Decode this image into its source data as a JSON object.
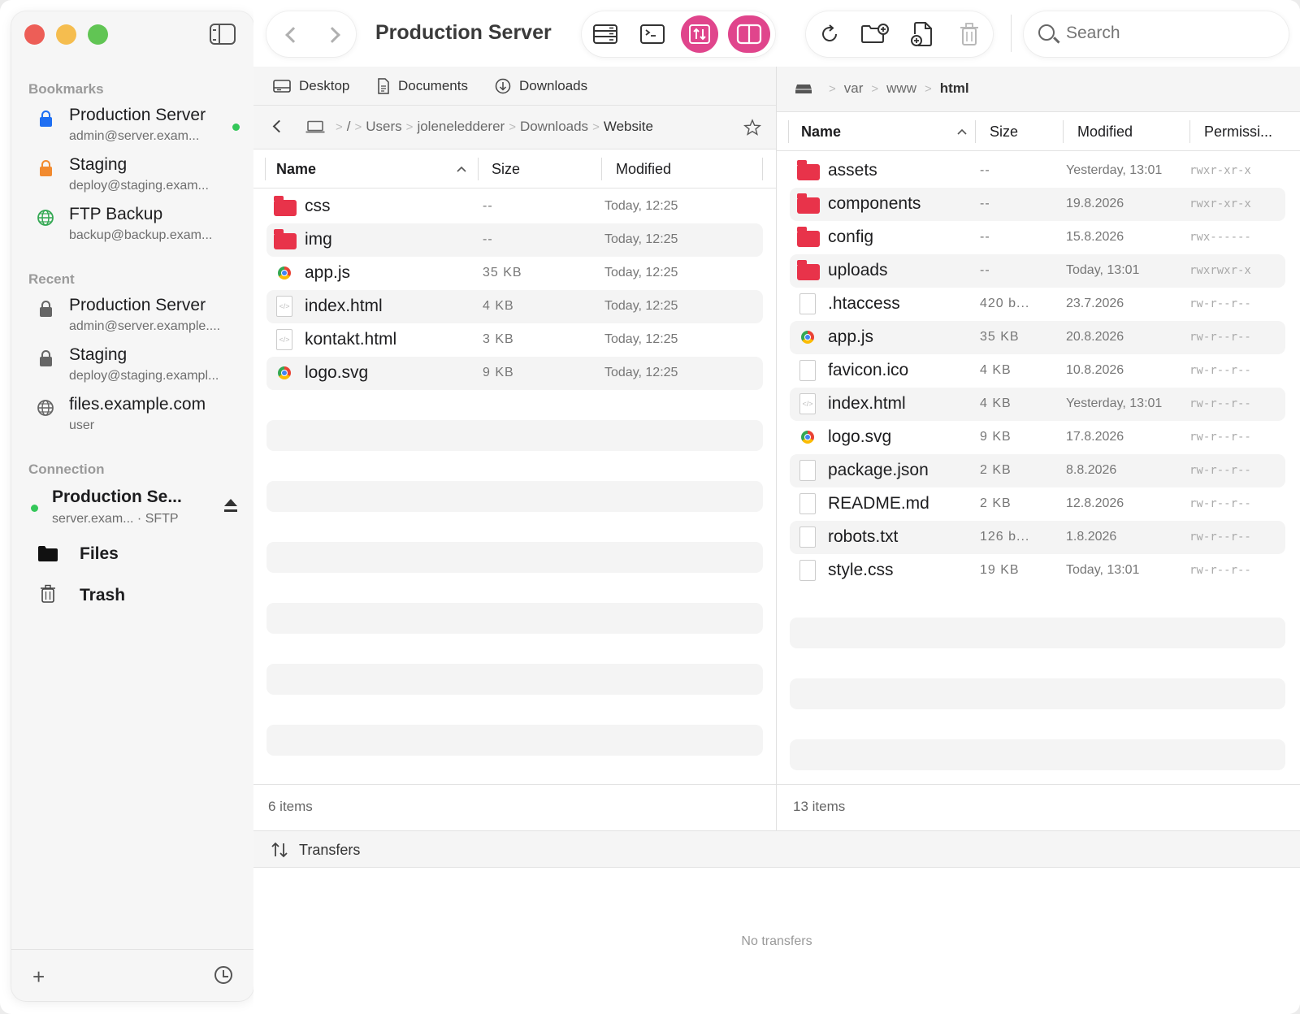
{
  "window": {
    "title": "Production Server",
    "traffic_lights": {
      "close": "#ed5e57",
      "minimize": "#f5bd4f",
      "zoom": "#61c554"
    }
  },
  "toolbar": {
    "title": "Production Server",
    "search_placeholder": "Search",
    "accent": "#e0458c",
    "buttons": [
      "server-list-icon",
      "terminal-icon",
      "transfer-mode-icon",
      "split-view-icon",
      "refresh-icon",
      "new-folder-icon",
      "new-file-icon",
      "trash-icon"
    ]
  },
  "sidebar": {
    "bookmarks_heading": "Bookmarks",
    "bookmarks": [
      {
        "title": "Production Server",
        "subtitle": "admin@server.exam...",
        "icon": "lock-icon",
        "color": "#1f6ff2",
        "connected": true
      },
      {
        "title": "Staging",
        "subtitle": "deploy@staging.exam...",
        "icon": "lock-icon",
        "color": "#f18a2f",
        "connected": false
      },
      {
        "title": "FTP Backup",
        "subtitle": "backup@backup.exam...",
        "icon": "globe-icon",
        "color": "#34a853",
        "connected": false
      }
    ],
    "recent_heading": "Recent",
    "recent": [
      {
        "title": "Production Server",
        "subtitle": "admin@server.example....",
        "icon": "lock-icon"
      },
      {
        "title": "Staging",
        "subtitle": "deploy@staging.exampl...",
        "icon": "lock-icon"
      },
      {
        "title": "files.example.com",
        "subtitle": "user",
        "icon": "globe-icon"
      }
    ],
    "connection_heading": "Connection",
    "connection": {
      "title": "Production Se...",
      "host": "server.exam...",
      "protocol": "SFTP"
    },
    "nav": [
      {
        "label": "Files",
        "icon": "folder-icon"
      },
      {
        "label": "Trash",
        "icon": "trash-icon"
      }
    ]
  },
  "local": {
    "favorites": [
      "Desktop",
      "Documents",
      "Downloads"
    ],
    "path": [
      "/",
      "Users",
      "joleneledderer",
      "Downloads",
      "Website"
    ],
    "columns": {
      "name": "Name",
      "size": "Size",
      "modified": "Modified"
    },
    "files": [
      {
        "name": "css",
        "size": "--",
        "modified": "Today, 12:25",
        "type": "folder"
      },
      {
        "name": "img",
        "size": "--",
        "modified": "Today, 12:25",
        "type": "folder"
      },
      {
        "name": "app.js",
        "size": "35 KB",
        "modified": "Today, 12:25",
        "type": "chrome"
      },
      {
        "name": "index.html",
        "size": "4 KB",
        "modified": "Today, 12:25",
        "type": "code"
      },
      {
        "name": "kontakt.html",
        "size": "3 KB",
        "modified": "Today, 12:25",
        "type": "code"
      },
      {
        "name": "logo.svg",
        "size": "9 KB",
        "modified": "Today, 12:25",
        "type": "chrome"
      }
    ],
    "status": "6 items"
  },
  "remote": {
    "path": [
      "var",
      "www",
      "html"
    ],
    "columns": {
      "name": "Name",
      "size": "Size",
      "modified": "Modified",
      "permissions": "Permissi..."
    },
    "files": [
      {
        "name": "assets",
        "size": "--",
        "modified": "Yesterday, 13:01",
        "perm": "rwxr-xr-x",
        "type": "folder"
      },
      {
        "name": "components",
        "size": "--",
        "modified": "19.8.2026",
        "perm": "rwxr-xr-x",
        "type": "folder"
      },
      {
        "name": "config",
        "size": "--",
        "modified": "15.8.2026",
        "perm": "rwx------",
        "type": "folder"
      },
      {
        "name": "uploads",
        "size": "--",
        "modified": "Today, 13:01",
        "perm": "rwxrwxr-x",
        "type": "folder"
      },
      {
        "name": ".htaccess",
        "size": "420 b...",
        "modified": "23.7.2026",
        "perm": "rw-r--r--",
        "type": "doc"
      },
      {
        "name": "app.js",
        "size": "35 KB",
        "modified": "20.8.2026",
        "perm": "rw-r--r--",
        "type": "chrome"
      },
      {
        "name": "favicon.ico",
        "size": "4 KB",
        "modified": "10.8.2026",
        "perm": "rw-r--r--",
        "type": "doc"
      },
      {
        "name": "index.html",
        "size": "4 KB",
        "modified": "Yesterday, 13:01",
        "perm": "rw-r--r--",
        "type": "code"
      },
      {
        "name": "logo.svg",
        "size": "9 KB",
        "modified": "17.8.2026",
        "perm": "rw-r--r--",
        "type": "chrome"
      },
      {
        "name": "package.json",
        "size": "2 KB",
        "modified": "8.8.2026",
        "perm": "rw-r--r--",
        "type": "doc"
      },
      {
        "name": "README.md",
        "size": "2 KB",
        "modified": "12.8.2026",
        "perm": "rw-r--r--",
        "type": "doc"
      },
      {
        "name": "robots.txt",
        "size": "126 b...",
        "modified": "1.8.2026",
        "perm": "rw-r--r--",
        "type": "doc"
      },
      {
        "name": "style.css",
        "size": "19 KB",
        "modified": "Today, 13:01",
        "perm": "rw-r--r--",
        "type": "doc"
      }
    ],
    "status": "13 items"
  },
  "transfers": {
    "title": "Transfers",
    "empty_text": "No transfers"
  }
}
